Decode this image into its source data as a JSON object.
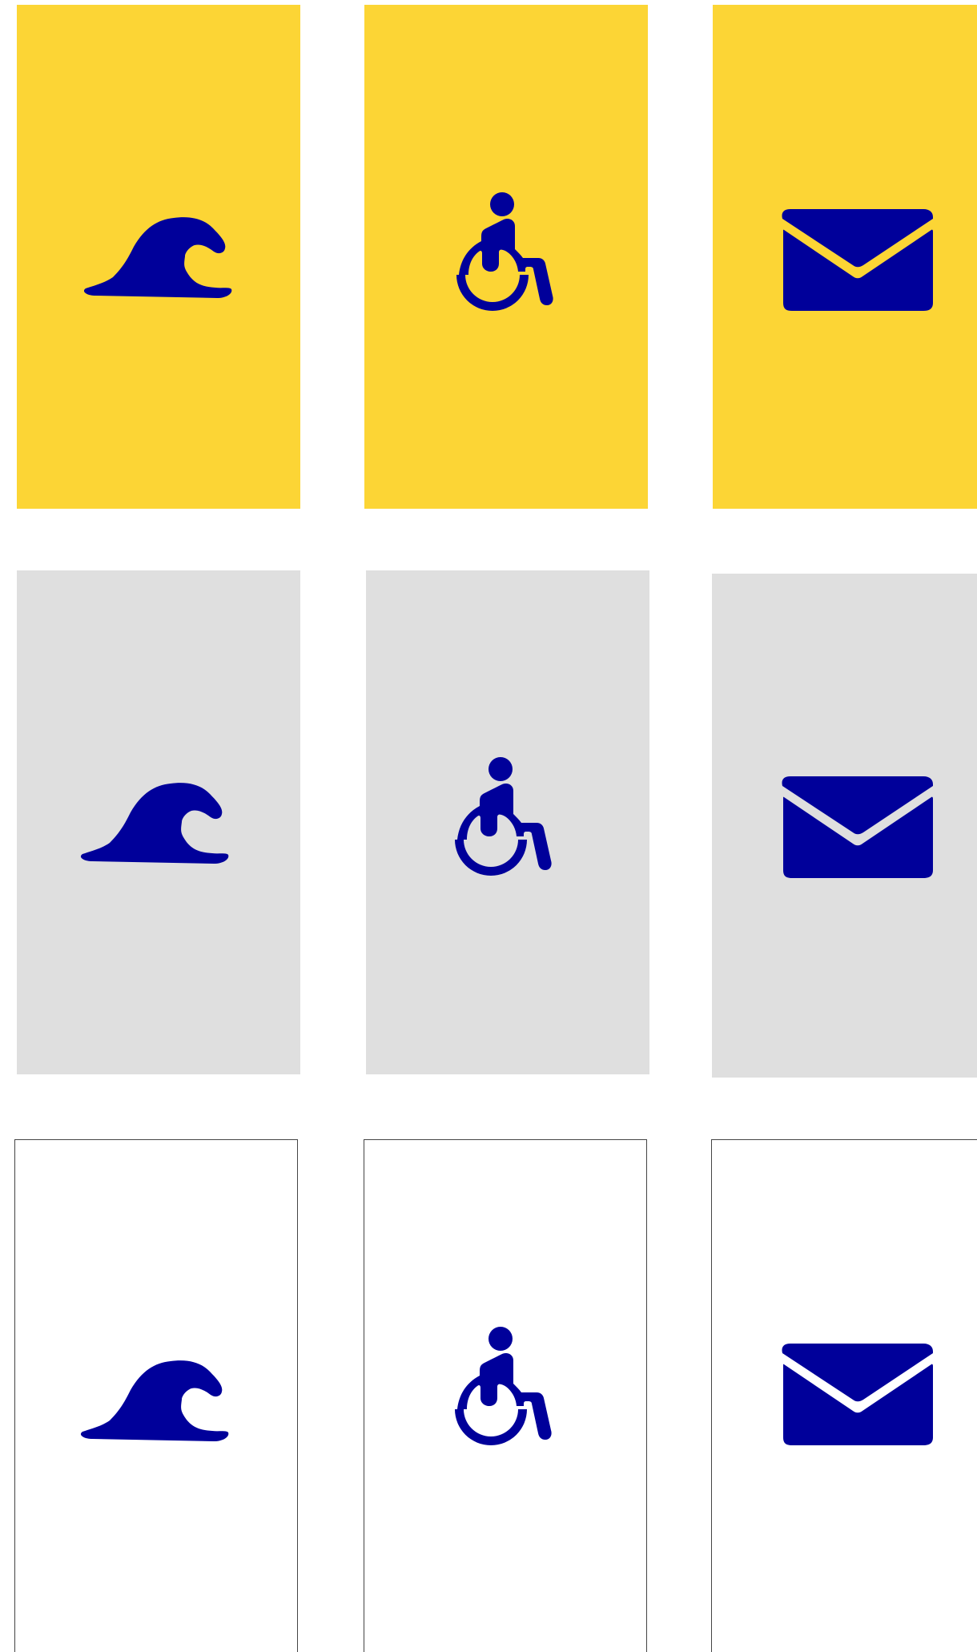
{
  "colors": {
    "icon": "#00009A",
    "yellow_card": "#FCD535",
    "grey_card": "#DFDFDF",
    "outline_card": "#FFFFFF"
  },
  "rows": [
    {
      "style": "yellow",
      "icons": [
        "wave-icon",
        "wheelchair-icon",
        "envelope-icon"
      ]
    },
    {
      "style": "grey",
      "icons": [
        "wave-icon",
        "wheelchair-icon",
        "envelope-icon"
      ]
    },
    {
      "style": "outline",
      "icons": [
        "wave-icon",
        "wheelchair-icon",
        "envelope-icon"
      ]
    }
  ]
}
